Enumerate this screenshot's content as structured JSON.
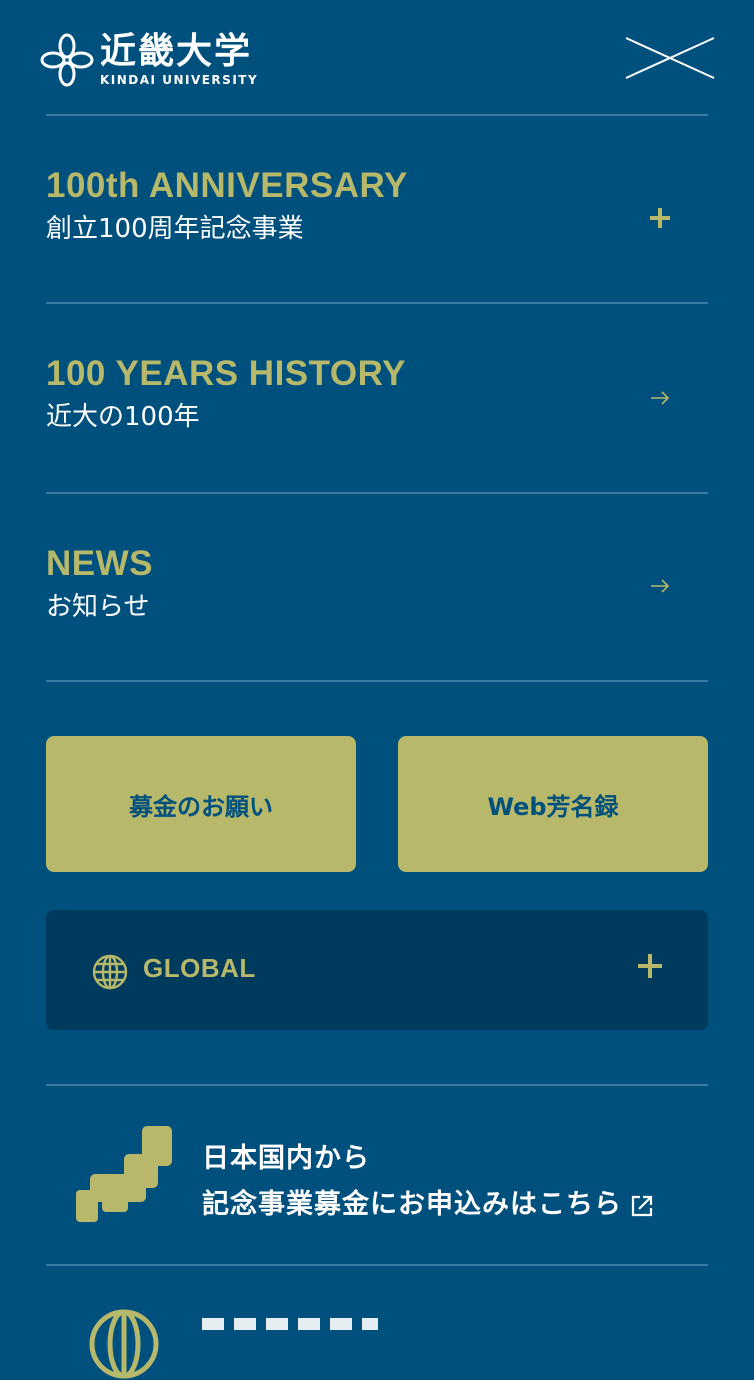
{
  "header": {
    "logo_kanji": "近畿大学",
    "logo_en": "KINDAI UNIVERSITY"
  },
  "nav": [
    {
      "en": "100th ANNIVERSARY",
      "jp": "創立100周年記念事業",
      "icon": "plus-icon"
    },
    {
      "en": "100 YEARS HISTORY",
      "jp": "近大の100年",
      "icon": "arrow-right-icon"
    },
    {
      "en": "NEWS",
      "jp": "お知らせ",
      "icon": "arrow-right-icon"
    }
  ],
  "buttons": {
    "donation": "募金のお願い",
    "web_roster": "Web芳名録"
  },
  "global": {
    "label": "GLOBAL",
    "icon": "globe-icon"
  },
  "domestic": {
    "line1": "日本国内から",
    "line2": "記念事業募金にお申込みはこちら"
  },
  "colors": {
    "background": "#00507e",
    "accent": "#b8b86a",
    "panel": "#003a5c",
    "divider": "#3a7aa3"
  }
}
